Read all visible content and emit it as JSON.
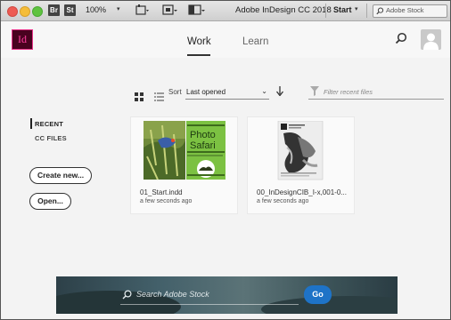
{
  "titlebar": {
    "app_badges": [
      "Br",
      "St"
    ],
    "zoom": "100%",
    "title": "Adobe InDesign CC 2018",
    "workspace": "Start",
    "stock_search_placeholder": "Adobe Stock"
  },
  "header": {
    "logo": "Id",
    "tabs": [
      {
        "label": "Work",
        "active": true
      },
      {
        "label": "Learn",
        "active": false
      }
    ]
  },
  "toolbar": {
    "sort_label": "Sort",
    "sort_value": "Last opened",
    "filter_placeholder": "Filter recent files"
  },
  "sidebar": {
    "items": [
      "RECENT",
      "CC FILES"
    ],
    "buttons": {
      "create": "Create new...",
      "open": "Open..."
    }
  },
  "recent_files": [
    {
      "name": "01_Start.indd",
      "time": "a few seconds ago",
      "thumb_text": [
        "Photo",
        "Safari"
      ]
    },
    {
      "name": "00_InDesignCIB_I-x,001-0...",
      "time": "a few seconds ago"
    }
  ],
  "footer": {
    "search_placeholder": "Search Adobe Stock",
    "go_label": "Go"
  },
  "colors": {
    "indesign_logo": "#49021f",
    "accent_pink": "#ff3fa0",
    "go_button": "#1e73c7",
    "photo_safari_green": "#7cc142"
  }
}
